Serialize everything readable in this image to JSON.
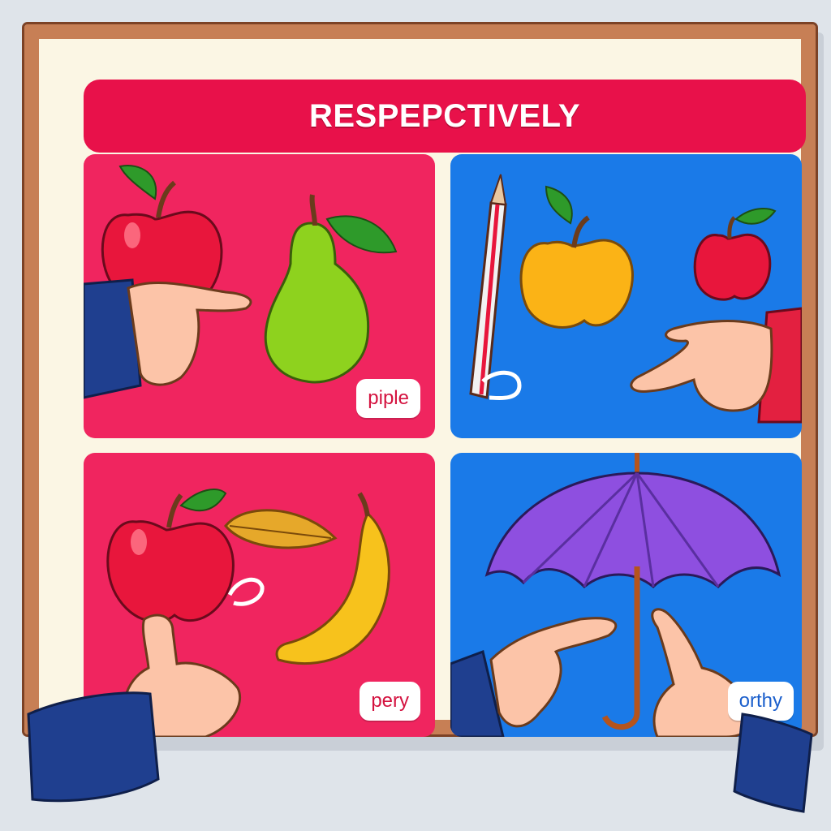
{
  "title": "RESPEPCTIVELY",
  "panels": [
    {
      "label": "piple"
    },
    {
      "label": ""
    },
    {
      "label": "pery"
    },
    {
      "label": "orthy"
    }
  ],
  "colors": {
    "title_bg": "#e8114a",
    "panel_red": "#f0255f",
    "panel_blue": "#1a7ae8",
    "frame": "#c77f55",
    "board": "#fbf6e4"
  },
  "icons": [
    "apple-icon",
    "pear-icon",
    "pencil-icon",
    "banana-icon",
    "leaf-icon",
    "umbrella-icon",
    "pointing-hand-icon"
  ]
}
